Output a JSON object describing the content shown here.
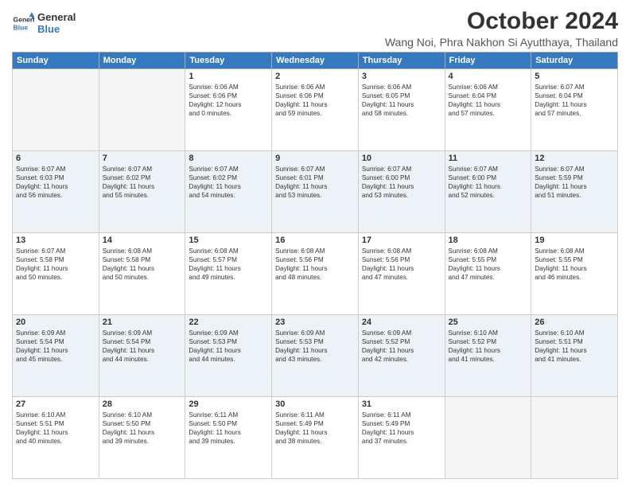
{
  "header": {
    "logo_line1": "General",
    "logo_line2": "Blue",
    "month": "October 2024",
    "location": "Wang Noi, Phra Nakhon Si Ayutthaya, Thailand"
  },
  "days_of_week": [
    "Sunday",
    "Monday",
    "Tuesday",
    "Wednesday",
    "Thursday",
    "Friday",
    "Saturday"
  ],
  "weeks": [
    {
      "row_class": "row-white",
      "days": [
        {
          "num": "",
          "info": "",
          "empty": true
        },
        {
          "num": "",
          "info": "",
          "empty": true
        },
        {
          "num": "1",
          "info": "Sunrise: 6:06 AM\nSunset: 6:06 PM\nDaylight: 12 hours\nand 0 minutes.",
          "empty": false
        },
        {
          "num": "2",
          "info": "Sunrise: 6:06 AM\nSunset: 6:06 PM\nDaylight: 11 hours\nand 59 minutes.",
          "empty": false
        },
        {
          "num": "3",
          "info": "Sunrise: 6:06 AM\nSunset: 6:05 PM\nDaylight: 11 hours\nand 58 minutes.",
          "empty": false
        },
        {
          "num": "4",
          "info": "Sunrise: 6:06 AM\nSunset: 6:04 PM\nDaylight: 11 hours\nand 57 minutes.",
          "empty": false
        },
        {
          "num": "5",
          "info": "Sunrise: 6:07 AM\nSunset: 6:04 PM\nDaylight: 11 hours\nand 57 minutes.",
          "empty": false
        }
      ]
    },
    {
      "row_class": "row-light",
      "days": [
        {
          "num": "6",
          "info": "Sunrise: 6:07 AM\nSunset: 6:03 PM\nDaylight: 11 hours\nand 56 minutes.",
          "empty": false
        },
        {
          "num": "7",
          "info": "Sunrise: 6:07 AM\nSunset: 6:02 PM\nDaylight: 11 hours\nand 55 minutes.",
          "empty": false
        },
        {
          "num": "8",
          "info": "Sunrise: 6:07 AM\nSunset: 6:02 PM\nDaylight: 11 hours\nand 54 minutes.",
          "empty": false
        },
        {
          "num": "9",
          "info": "Sunrise: 6:07 AM\nSunset: 6:01 PM\nDaylight: 11 hours\nand 53 minutes.",
          "empty": false
        },
        {
          "num": "10",
          "info": "Sunrise: 6:07 AM\nSunset: 6:00 PM\nDaylight: 11 hours\nand 53 minutes.",
          "empty": false
        },
        {
          "num": "11",
          "info": "Sunrise: 6:07 AM\nSunset: 6:00 PM\nDaylight: 11 hours\nand 52 minutes.",
          "empty": false
        },
        {
          "num": "12",
          "info": "Sunrise: 6:07 AM\nSunset: 5:59 PM\nDaylight: 11 hours\nand 51 minutes.",
          "empty": false
        }
      ]
    },
    {
      "row_class": "row-white",
      "days": [
        {
          "num": "13",
          "info": "Sunrise: 6:07 AM\nSunset: 5:58 PM\nDaylight: 11 hours\nand 50 minutes.",
          "empty": false
        },
        {
          "num": "14",
          "info": "Sunrise: 6:08 AM\nSunset: 5:58 PM\nDaylight: 11 hours\nand 50 minutes.",
          "empty": false
        },
        {
          "num": "15",
          "info": "Sunrise: 6:08 AM\nSunset: 5:57 PM\nDaylight: 11 hours\nand 49 minutes.",
          "empty": false
        },
        {
          "num": "16",
          "info": "Sunrise: 6:08 AM\nSunset: 5:56 PM\nDaylight: 11 hours\nand 48 minutes.",
          "empty": false
        },
        {
          "num": "17",
          "info": "Sunrise: 6:08 AM\nSunset: 5:56 PM\nDaylight: 11 hours\nand 47 minutes.",
          "empty": false
        },
        {
          "num": "18",
          "info": "Sunrise: 6:08 AM\nSunset: 5:55 PM\nDaylight: 11 hours\nand 47 minutes.",
          "empty": false
        },
        {
          "num": "19",
          "info": "Sunrise: 6:08 AM\nSunset: 5:55 PM\nDaylight: 11 hours\nand 46 minutes.",
          "empty": false
        }
      ]
    },
    {
      "row_class": "row-light",
      "days": [
        {
          "num": "20",
          "info": "Sunrise: 6:09 AM\nSunset: 5:54 PM\nDaylight: 11 hours\nand 45 minutes.",
          "empty": false
        },
        {
          "num": "21",
          "info": "Sunrise: 6:09 AM\nSunset: 5:54 PM\nDaylight: 11 hours\nand 44 minutes.",
          "empty": false
        },
        {
          "num": "22",
          "info": "Sunrise: 6:09 AM\nSunset: 5:53 PM\nDaylight: 11 hours\nand 44 minutes.",
          "empty": false
        },
        {
          "num": "23",
          "info": "Sunrise: 6:09 AM\nSunset: 5:53 PM\nDaylight: 11 hours\nand 43 minutes.",
          "empty": false
        },
        {
          "num": "24",
          "info": "Sunrise: 6:09 AM\nSunset: 5:52 PM\nDaylight: 11 hours\nand 42 minutes.",
          "empty": false
        },
        {
          "num": "25",
          "info": "Sunrise: 6:10 AM\nSunset: 5:52 PM\nDaylight: 11 hours\nand 41 minutes.",
          "empty": false
        },
        {
          "num": "26",
          "info": "Sunrise: 6:10 AM\nSunset: 5:51 PM\nDaylight: 11 hours\nand 41 minutes.",
          "empty": false
        }
      ]
    },
    {
      "row_class": "row-white",
      "days": [
        {
          "num": "27",
          "info": "Sunrise: 6:10 AM\nSunset: 5:51 PM\nDaylight: 11 hours\nand 40 minutes.",
          "empty": false
        },
        {
          "num": "28",
          "info": "Sunrise: 6:10 AM\nSunset: 5:50 PM\nDaylight: 11 hours\nand 39 minutes.",
          "empty": false
        },
        {
          "num": "29",
          "info": "Sunrise: 6:11 AM\nSunset: 5:50 PM\nDaylight: 11 hours\nand 39 minutes.",
          "empty": false
        },
        {
          "num": "30",
          "info": "Sunrise: 6:11 AM\nSunset: 5:49 PM\nDaylight: 11 hours\nand 38 minutes.",
          "empty": false
        },
        {
          "num": "31",
          "info": "Sunrise: 6:11 AM\nSunset: 5:49 PM\nDaylight: 11 hours\nand 37 minutes.",
          "empty": false
        },
        {
          "num": "",
          "info": "",
          "empty": true
        },
        {
          "num": "",
          "info": "",
          "empty": true
        }
      ]
    }
  ]
}
